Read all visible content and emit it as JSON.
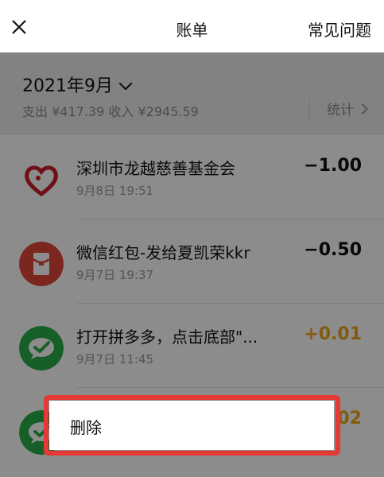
{
  "nav": {
    "title": "账单",
    "faq": "常见问题"
  },
  "summary": {
    "month": "2021年9月",
    "expense_label": "支出",
    "expense": "¥417.39",
    "income_label": "收入",
    "income": "¥2945.59",
    "stats": "统计"
  },
  "transactions": [
    {
      "name": "深圳市龙越慈善基金会",
      "time": "9月8日 19:51",
      "amount": "−1.00",
      "icon": "charity-heart-icon"
    },
    {
      "name": "微信红包-发给夏凯荣kkr",
      "time": "9月7日 19:37",
      "amount": "−0.50",
      "icon": "red-envelope-icon"
    },
    {
      "name": "打开拼多多，点击底部\"...",
      "time": "9月7日 11:45",
      "amount": "+0.01",
      "icon": "wechat-pay-icon"
    },
    {
      "name": "",
      "time": "",
      "amount": "02",
      "icon": "wechat-pay-icon"
    }
  ],
  "action_sheet": {
    "delete": "删除"
  },
  "colors": {
    "highlight": "#e53935",
    "positive_amount": "#f1a61a"
  }
}
